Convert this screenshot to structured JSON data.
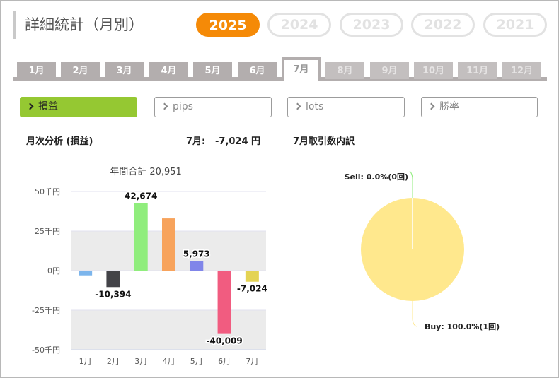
{
  "page": {
    "title": "詳細統計（月別）"
  },
  "years": [
    {
      "label": "2025",
      "active": true
    },
    {
      "label": "2024",
      "active": false
    },
    {
      "label": "2023",
      "active": false
    },
    {
      "label": "2022",
      "active": false
    },
    {
      "label": "2021",
      "active": false
    }
  ],
  "months": [
    {
      "label": "1月",
      "state": "normal"
    },
    {
      "label": "2月",
      "state": "normal"
    },
    {
      "label": "3月",
      "state": "normal"
    },
    {
      "label": "4月",
      "state": "normal"
    },
    {
      "label": "5月",
      "state": "normal"
    },
    {
      "label": "6月",
      "state": "normal"
    },
    {
      "label": "7月",
      "state": "active"
    },
    {
      "label": "8月",
      "state": "disabled"
    },
    {
      "label": "9月",
      "state": "disabled"
    },
    {
      "label": "10月",
      "state": "disabled"
    },
    {
      "label": "11月",
      "state": "disabled"
    },
    {
      "label": "12月",
      "state": "disabled"
    }
  ],
  "metrics": [
    {
      "label": "損益",
      "active": true
    },
    {
      "label": "pips",
      "active": false
    },
    {
      "label": "lots",
      "active": false
    },
    {
      "label": "勝率",
      "active": false
    }
  ],
  "analysis": {
    "heading": "月次分析 (損益)",
    "month_summary_label": "7月:",
    "month_summary_value": "-7,024 円",
    "breakdown_heading": "7月取引数内訳"
  },
  "colors": {
    "accent": "#f58a07",
    "metric_active": "#95c832",
    "tab": "#b3aeae"
  },
  "chart_data": [
    {
      "type": "bar",
      "title": "年間合計 20,951",
      "categories": [
        "1月",
        "2月",
        "3月",
        "4月",
        "5月",
        "6月",
        "7月"
      ],
      "values": [
        -3000,
        -10394,
        42674,
        33000,
        5973,
        -40009,
        -7024
      ],
      "data_labels": [
        "",
        "-10,394",
        "42,674",
        "",
        "5,973",
        "-40,009",
        "-7,024"
      ],
      "colors": [
        "#7cb5ec",
        "#434348",
        "#90ed7d",
        "#f7a35c",
        "#8085e9",
        "#f15c80",
        "#e4d354"
      ],
      "yticks": [
        50000,
        25000,
        0,
        -25000,
        -50000
      ],
      "ytick_labels": [
        "50千円",
        "25千円",
        "0円",
        "-25千円",
        "-50千円"
      ],
      "ylim": [
        -50000,
        50000
      ],
      "grid": "alternating bands"
    },
    {
      "type": "pie",
      "slices": [
        {
          "label": "Sell: 0.0%(0回)",
          "value": 0,
          "color": "#90ed7d"
        },
        {
          "label": "Buy: 100.0%(1回)",
          "value": 100,
          "color": "#ffe88d"
        }
      ]
    }
  ]
}
